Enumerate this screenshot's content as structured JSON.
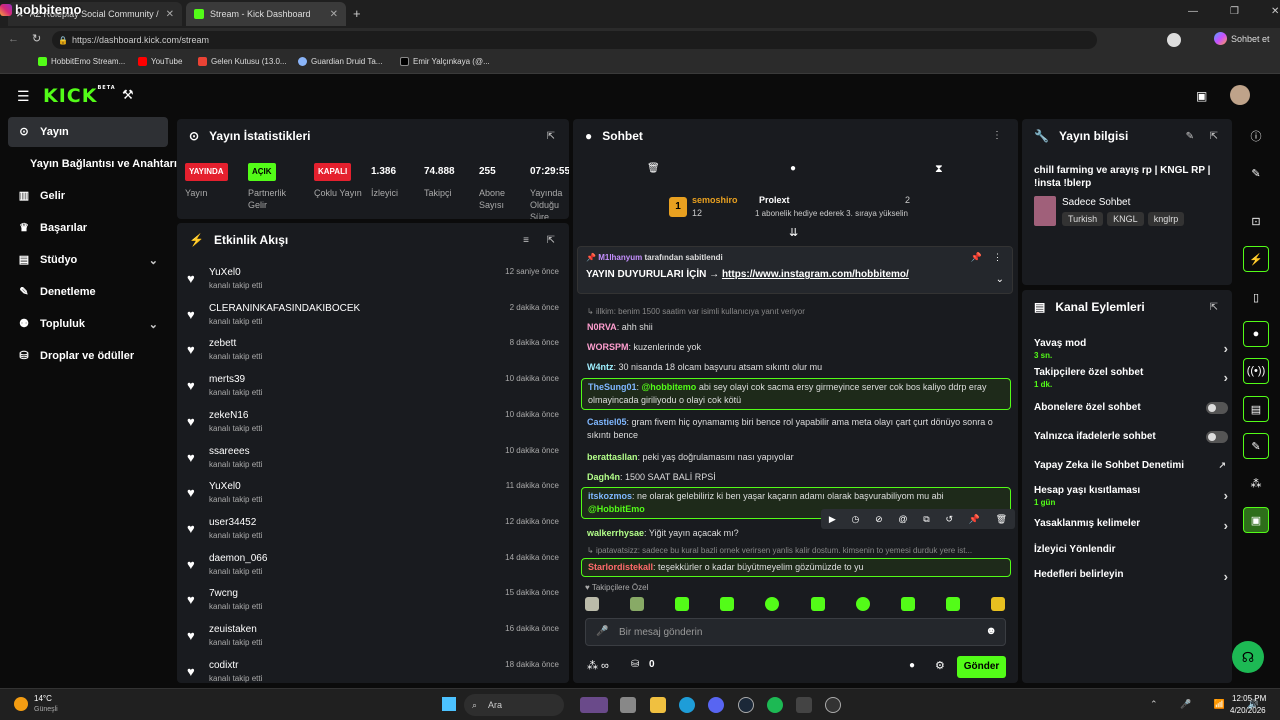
{
  "browser": {
    "overlay_name": "hobbitemo",
    "tab1_label": "AZ Roleplay Social Community / X",
    "tab2_label": "Stream - Kick Dashboard",
    "url": "https://dashboard.kick.com/stream",
    "copilot_label": "Sohbet et",
    "bookmarks": [
      "HobbitEmo Stream...",
      "YouTube",
      "Gelen Kutusu (13.0...",
      "Guardian Druid Ta...",
      "Emir Yalçınkaya (@..."
    ]
  },
  "kick": {
    "logo": "KICK",
    "beta": "BETA"
  },
  "nav": {
    "items": [
      {
        "label": "Yayın",
        "icon": "broadcast-icon"
      },
      {
        "label": "Yayın Bağlantısı ve Anahtarı",
        "icon": ""
      },
      {
        "label": "Gelir",
        "icon": "chart-icon"
      },
      {
        "label": "Başarılar",
        "icon": "trophy-icon"
      },
      {
        "label": "Stüdyo",
        "icon": "studio-icon"
      },
      {
        "label": "Denetleme",
        "icon": "wrench-icon"
      },
      {
        "label": "Topluluk",
        "icon": "people-icon"
      },
      {
        "label": "Droplar ve ödüller",
        "icon": "gift-icon"
      }
    ]
  },
  "stats": {
    "title": "Yayın İstatistikleri",
    "items": [
      {
        "badge": "YAYINDA",
        "label": "Yayın"
      },
      {
        "badge": "AÇIK",
        "label": "Partnerlik Gelir"
      },
      {
        "badge": "KAPALI",
        "label": "Çoklu Yayın"
      },
      {
        "value": "1.386",
        "label": "İzleyici"
      },
      {
        "value": "74.888",
        "label": "Takipçi"
      },
      {
        "value": "255",
        "label": "Abone Sayısı"
      },
      {
        "value": "07:29:55",
        "label": "Yayında Olduğu Süre"
      }
    ]
  },
  "events": {
    "title": "Etkinlik Akışı",
    "items": [
      {
        "name": "YuXel0",
        "sub": "kanalı takip etti",
        "time": "12 saniye önce"
      },
      {
        "name": "CLERANINKAFASINDAKIBOCEK",
        "sub": "kanalı takip etti",
        "time": "2 dakika önce"
      },
      {
        "name": "zebett",
        "sub": "kanalı takip etti",
        "time": "8 dakika önce"
      },
      {
        "name": "merts39",
        "sub": "kanalı takip etti",
        "time": "10 dakika önce"
      },
      {
        "name": "zekeN16",
        "sub": "kanalı takip etti",
        "time": "10 dakika önce"
      },
      {
        "name": "ssareees",
        "sub": "kanalı takip etti",
        "time": "10 dakika önce"
      },
      {
        "name": "YuXel0",
        "sub": "kanalı takip etti",
        "time": "11 dakika önce"
      },
      {
        "name": "user34452",
        "sub": "kanalı takip etti",
        "time": "12 dakika önce"
      },
      {
        "name": "daemon_066",
        "sub": "kanalı takip etti",
        "time": "14 dakika önce"
      },
      {
        "name": "7wcng",
        "sub": "kanalı takip etti",
        "time": "15 dakika önce"
      },
      {
        "name": "zeuistaken",
        "sub": "kanalı takip etti",
        "time": "16 dakika önce"
      },
      {
        "name": "codixtr",
        "sub": "kanalı takip etti",
        "time": "18 dakika önce"
      }
    ]
  },
  "chat": {
    "title": "Sohbet",
    "leader": {
      "rank": "1",
      "name": "semoshiro",
      "count": "12",
      "other": "Prolext",
      "other_count": "2",
      "note": "1 abonelik hediye ederek 3. sıraya yükselin"
    },
    "pinned_by": "M1lhanyum",
    "pinned_by_suffix": "tarafından sabitlendi",
    "pinned_text": "YAYIN DUYURULARI İÇİN →",
    "pinned_link": "https://www.instagram.com/hobbitemo/",
    "messages": [
      {
        "reply": "illkim: benim 1500 saatim var isimli kullanıcıya yanıt veriyor",
        "user": "N0RVA",
        "color": "#ff9ecf",
        "text": "ahh shii"
      },
      {
        "user": "WORSPM",
        "color": "#ff9ecf",
        "text": "kuzenlerinde yok"
      },
      {
        "user": "W4ntz",
        "color": "#9ef0ff",
        "text": "30 nisanda 18 olcam başvuru atsam sıkıntı olur mu"
      },
      {
        "user": "TheSung01",
        "color": "#7fb7ff",
        "mention": "@hobbitemo",
        "text": "abi sey olayi cok sacma ersy girmeyince server cok bos kaliyo ddrp eray olmayincada giriliyodu o olayi cok kötü"
      },
      {
        "user": "Castiel05",
        "color": "#7fb7ff",
        "text": "gram fivem hiç oynamamış biri bence rol yapabilir ama meta olayı çart çurt dönüyo sonra o sıkıntı bence"
      },
      {
        "user": "berattasllan",
        "color": "#b3ff8a",
        "text": "peki yaş doğrulamasını nası yapıyolar"
      },
      {
        "user": "Dagh4n",
        "color": "#b3ff8a",
        "text": "1500 SAAT BALİ RPSİ"
      },
      {
        "user": "itskozmos",
        "color": "#7fb7ff",
        "text": "ne olarak gelebiliriz ki ben yaşar kaçarın adamı olarak başvurabiliyom mu abi",
        "mention2": "@HobbitEmo"
      },
      {
        "user": "walkerrhysae",
        "color": "#b3ff8a",
        "text": "Yiğit yayın açacak mı?"
      },
      {
        "reply": "ipatavatsizz: sadece bu kural bazli ornek verirsen yanlis kalir dostum. kimsenin to yemesi durduk yere ist...",
        "user": "Starlordistekall",
        "color": "#ff6b6b",
        "text": "teşekkürler o kadar büyütmeyelim gözümüzde to yu"
      }
    ],
    "followers_only": "Takipçilere Özel",
    "input_placeholder": "Bir mesaj gönderin",
    "count": "0",
    "send": "Gönder"
  },
  "streaminfo": {
    "title": "Yayın bilgisi",
    "stream_title": "chill farming ve arayış rp | KNGL RP | !insta !blerp",
    "category": "Sadece Sohbet",
    "tags": [
      "Turkish",
      "KNGL",
      "knglrp"
    ]
  },
  "channel": {
    "title": "Kanal Eylemleri",
    "actions": [
      {
        "label": "Yavaş mod",
        "sub": "3 sn.",
        "type": "chev"
      },
      {
        "label": "Takipçilere özel sohbet",
        "sub": "1 dk.",
        "type": "chev"
      },
      {
        "label": "Abonelere özel sohbet",
        "type": "toggle"
      },
      {
        "label": "Yalnızca ifadelerle sohbet",
        "type": "toggle"
      },
      {
        "label": "Yapay Zeka ile Sohbet Denetimi",
        "type": "ext"
      },
      {
        "label": "Hesap yaşı kısıtlaması",
        "sub": "1 gün",
        "type": "chev"
      },
      {
        "label": "Yasaklanmış kelimeler",
        "type": "chev"
      },
      {
        "label": "İzleyici Yönlendir",
        "type": "none"
      },
      {
        "label": "Hedefleri belirleyin",
        "type": "chev"
      }
    ]
  },
  "taskbar": {
    "weather": "14°C",
    "weather_sub": "Güneşli",
    "search": "Ara",
    "time": "12:05 PM",
    "date": "4/20/2026"
  },
  "colors": {
    "accent": "#53fc18",
    "panel": "#191b1f",
    "live": "#e5202e"
  }
}
